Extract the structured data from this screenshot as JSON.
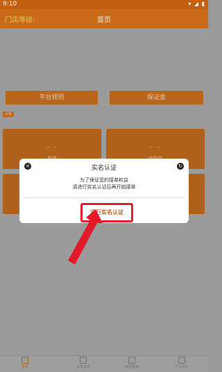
{
  "status_bar": {
    "time": "9:10",
    "icons": [
      "settings-icon",
      "wifi-icon",
      "signal-icon",
      "battery-icon"
    ]
  },
  "header": {
    "store_level": "门店等级:",
    "title": "首页"
  },
  "actions": {
    "platform_rules": "平台规则",
    "deposit": "保证金"
  },
  "section_tag": "公告",
  "cards": [
    {
      "value": "- -",
      "label": "单数"
    },
    {
      "value": "- -",
      "label": "待接单"
    },
    {
      "value": "",
      "label": ""
    },
    {
      "value": "",
      "label": ""
    }
  ],
  "modal": {
    "title": "实名认证",
    "line1": "为了保证您的接单权益",
    "line2": "请进行实名认证后再开始接单",
    "button": "进行实名认证"
  },
  "bottom_nav": [
    {
      "label": "首页",
      "icon": "home-icon",
      "active": true
    },
    {
      "label": "订单大厅",
      "icon": "clipboard-icon",
      "active": false
    },
    {
      "label": "社区发布",
      "icon": "chat-icon",
      "active": false
    },
    {
      "label": "个人中心",
      "icon": "person-icon",
      "active": false
    }
  ],
  "colors": {
    "accent": "#c96a18",
    "highlight_border": "#e21a2a",
    "overlay": "#9b9b9b"
  }
}
